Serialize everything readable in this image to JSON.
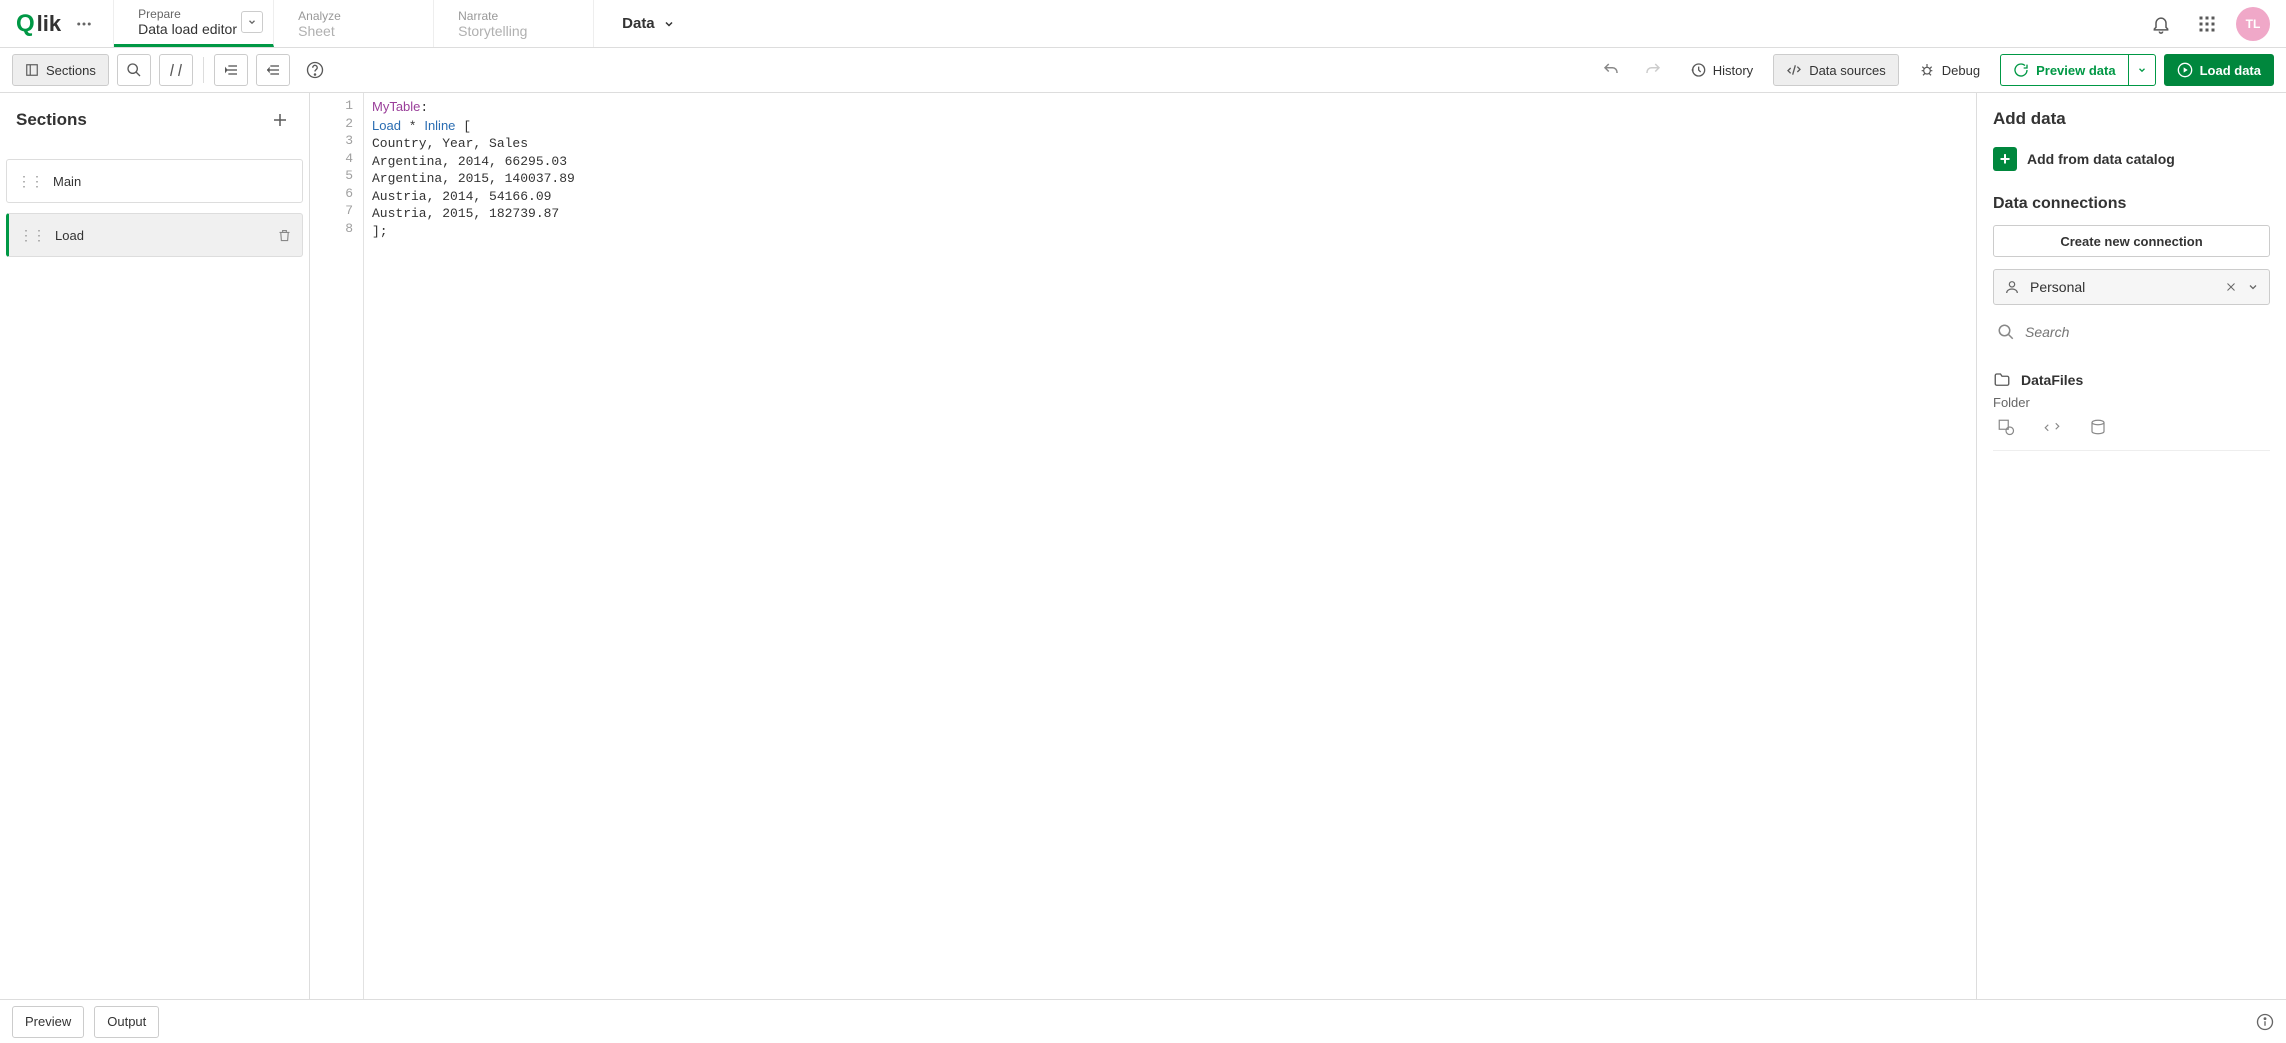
{
  "topnav": {
    "logo_text": "lik",
    "tabs": [
      {
        "top": "Prepare",
        "bottom": "Data load editor",
        "active": true,
        "hasChevron": true
      },
      {
        "top": "Analyze",
        "bottom": "Sheet",
        "active": false,
        "hasChevron": false
      },
      {
        "top": "Narrate",
        "bottom": "Storytelling",
        "active": false,
        "hasChevron": false
      }
    ],
    "data_label": "Data",
    "avatar_initials": "TL"
  },
  "toolbar": {
    "sections_btn": "Sections",
    "history": "History",
    "data_sources": "Data sources",
    "debug": "Debug",
    "preview_data": "Preview data",
    "load_data": "Load data"
  },
  "left_panel": {
    "title": "Sections",
    "items": [
      {
        "label": "Main",
        "active": false
      },
      {
        "label": "Load",
        "active": true
      }
    ]
  },
  "editor": {
    "lines": [
      {
        "n": "1",
        "tokens": [
          {
            "t": "MyTable",
            "c": "tk-tab"
          },
          {
            "t": ":",
            "c": ""
          }
        ]
      },
      {
        "n": "2",
        "tokens": [
          {
            "t": "Load",
            "c": "tk-kw"
          },
          {
            "t": " * ",
            "c": ""
          },
          {
            "t": "Inline",
            "c": "tk-kw"
          },
          {
            "t": " [",
            "c": ""
          }
        ]
      },
      {
        "n": "3",
        "tokens": [
          {
            "t": "Country, Year, Sales",
            "c": ""
          }
        ]
      },
      {
        "n": "4",
        "tokens": [
          {
            "t": "Argentina, 2014, 66295.03",
            "c": ""
          }
        ]
      },
      {
        "n": "5",
        "tokens": [
          {
            "t": "Argentina, 2015, 140037.89",
            "c": ""
          }
        ]
      },
      {
        "n": "6",
        "tokens": [
          {
            "t": "Austria, 2014, 54166.09",
            "c": ""
          }
        ]
      },
      {
        "n": "7",
        "tokens": [
          {
            "t": "Austria, 2015, 182739.87",
            "c": ""
          }
        ]
      },
      {
        "n": "8",
        "tokens": [
          {
            "t": "];",
            "c": ""
          }
        ]
      }
    ]
  },
  "right_panel": {
    "add_data_title": "Add data",
    "add_from_catalog": "Add from data catalog",
    "data_connections_title": "Data connections",
    "create_connection": "Create new connection",
    "space_name": "Personal",
    "search_placeholder": "Search",
    "folder_name": "DataFiles",
    "folder_type": "Folder"
  },
  "footer": {
    "preview": "Preview",
    "output": "Output"
  }
}
